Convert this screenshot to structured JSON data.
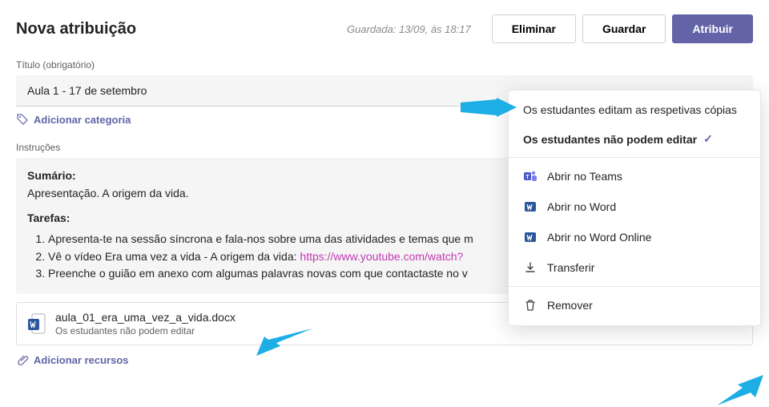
{
  "header": {
    "page_title": "Nova atribuição",
    "saved_status": "Guardada: 13/09, às 18:17",
    "btn_delete": "Eliminar",
    "btn_save": "Guardar",
    "btn_assign": "Atribuir"
  },
  "title_field": {
    "label": "Título (obrigatório)",
    "value": "Aula 1 - 17 de setembro"
  },
  "add_category": "Adicionar categoria",
  "instructions": {
    "label": "Instruções",
    "summary_h": "Sumário:",
    "summary_t": "Apresentação. A origem da vida.",
    "tasks_h": "Tarefas:",
    "t1": "Apresenta-te na sessão síncrona e fala-nos sobre uma das atividades e temas que m",
    "t2a": "Vê o vídeo Era uma vez a vida - A origem da vida: ",
    "t2b": "https://www.youtube.com/watch?",
    "t3": "Preenche o guião em anexo com algumas palavras novas com que contactaste no v"
  },
  "attachment": {
    "filename": "aula_01_era_uma_vez_a_vida.docx",
    "subtitle": "Os estudantes não podem editar",
    "more": "•••"
  },
  "add_resources": "Adicionar recursos",
  "menu": {
    "opt_edit_own": "Os estudantes editam as respetivas cópias",
    "opt_no_edit": "Os estudantes não podem editar",
    "open_teams": "Abrir no Teams",
    "open_word": "Abrir no Word",
    "open_word_online": "Abrir no Word Online",
    "download": "Transferir",
    "remove": "Remover"
  }
}
